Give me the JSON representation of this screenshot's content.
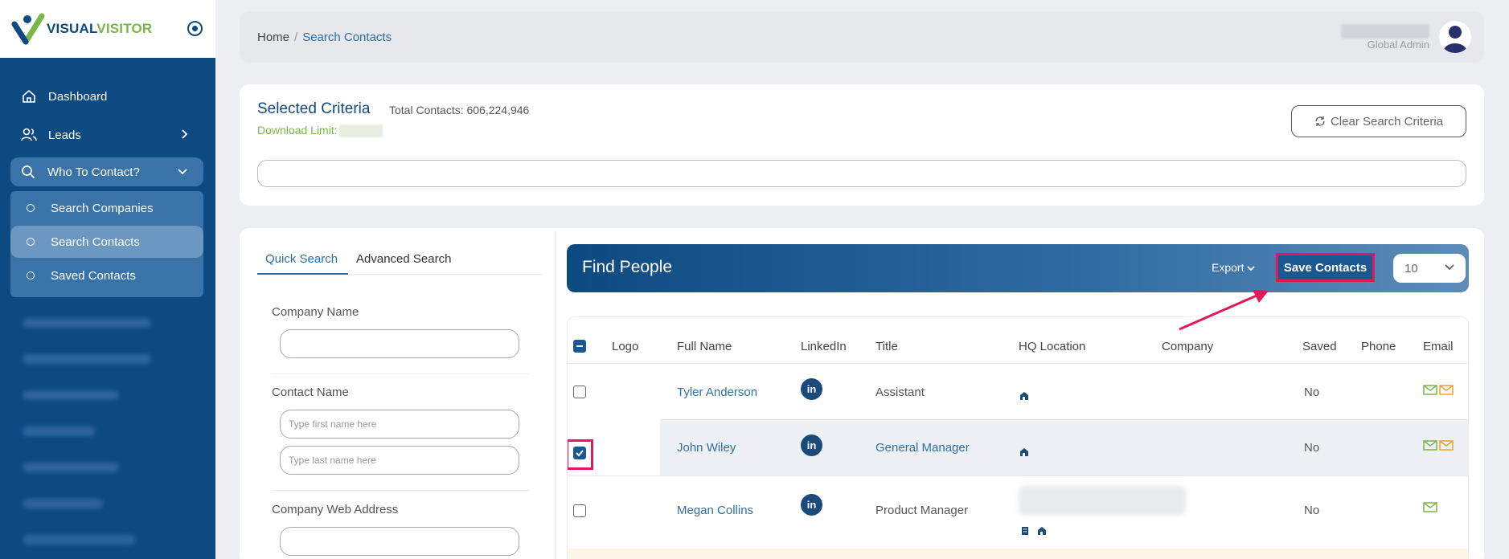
{
  "sidebar": {
    "logo": {
      "part1": "VISUAL",
      "part2": "VISITOR"
    },
    "items": [
      {
        "label": "Dashboard",
        "icon": "home-icon"
      },
      {
        "label": "Leads",
        "icon": "users-icon"
      },
      {
        "label": "Who To Contact?",
        "icon": "search-icon"
      }
    ],
    "submenu": [
      {
        "label": "Search Companies"
      },
      {
        "label": "Search Contacts"
      },
      {
        "label": "Saved Contacts"
      }
    ]
  },
  "header": {
    "breadcrumb": {
      "home": "Home",
      "separator": "/",
      "current": "Search Contacts"
    },
    "user_role": "Global Admin"
  },
  "criteria": {
    "title": "Selected Criteria",
    "total": "Total Contacts: 606,224,946",
    "download_label": "Download Limit:",
    "clear_button": "Clear Search Criteria"
  },
  "search": {
    "tabs": {
      "quick": "Quick Search",
      "advanced": "Advanced Search"
    },
    "company_name_label": "Company Name",
    "contact_name_label": "Contact Name",
    "first_name_placeholder": "Type first name here",
    "last_name_placeholder": "Type last name here",
    "web_address_label": "Company Web Address"
  },
  "find_people": {
    "title": "Find People",
    "export_label": "Export",
    "save_label": "Save Contacts",
    "per_page": "10"
  },
  "table": {
    "columns": [
      "Logo",
      "Full Name",
      "LinkedIn",
      "Title",
      "HQ Location",
      "Company",
      "Saved",
      "Phone",
      "Email"
    ],
    "linkedin_glyph": "in",
    "rows": [
      {
        "name": "Tyler Anderson",
        "title": "Assistant",
        "saved": "No",
        "checked": false
      },
      {
        "name": "John Wiley",
        "title": "General Manager",
        "saved": "No",
        "checked": true
      },
      {
        "name": "Megan Collins",
        "title": "Product Manager",
        "saved": "No",
        "checked": false
      }
    ]
  },
  "colors": {
    "sidebar": "#0d4a82",
    "accent": "#2f6ea5",
    "green": "#7ab648",
    "highlight": "#e0195a"
  }
}
